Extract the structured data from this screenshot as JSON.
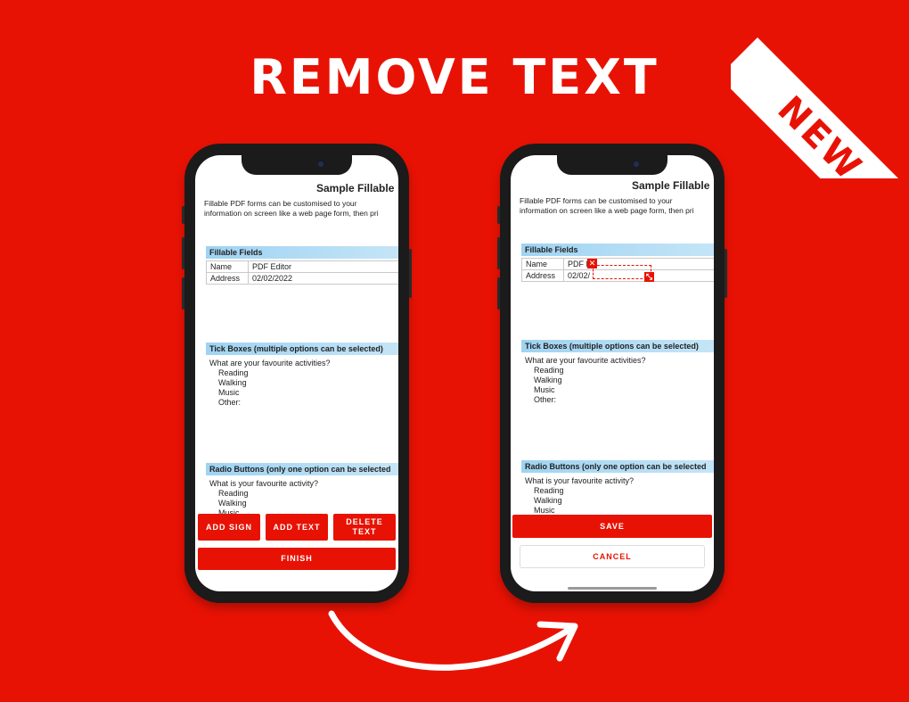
{
  "headline": "REMOVE TEXT",
  "corner_badge": "NEW",
  "doc": {
    "title": "Sample Fillable",
    "intro_line1": "Fillable PDF forms can be customised to your",
    "intro_line2": "information on screen like a web page form, then pri",
    "section_fields": "Fillable Fields",
    "fields": [
      {
        "label": "Name",
        "value": "PDF Editor"
      },
      {
        "label": "Address",
        "value": "02/02/2022"
      }
    ],
    "section_tick": "Tick Boxes (multiple options can be selected)",
    "tick_question": "What are your favourite activities?",
    "tick_options": [
      "Reading",
      "Walking",
      "Music",
      "Other:"
    ],
    "section_radio": "Radio Buttons (only one option can be selected",
    "radio_question": "What is your favourite activity?",
    "radio_options": [
      "Reading",
      "Walking",
      "Music"
    ]
  },
  "left_phone": {
    "buttons": {
      "add_sign": "ADD SIGN",
      "add_text": "ADD TEXT",
      "delete_text": "DELETE TEXT",
      "finish": "FINISH"
    }
  },
  "right_phone": {
    "editing_value_name": "PDF E",
    "editing_value_address": "02/02/",
    "buttons": {
      "save": "SAVE",
      "cancel": "CANCEL"
    }
  },
  "colors": {
    "background": "#e81204",
    "section_bar": "#9fd3f2",
    "accent": "#e81204"
  },
  "icons": [
    "close-icon",
    "resize-icon",
    "curved-arrow-icon"
  ]
}
